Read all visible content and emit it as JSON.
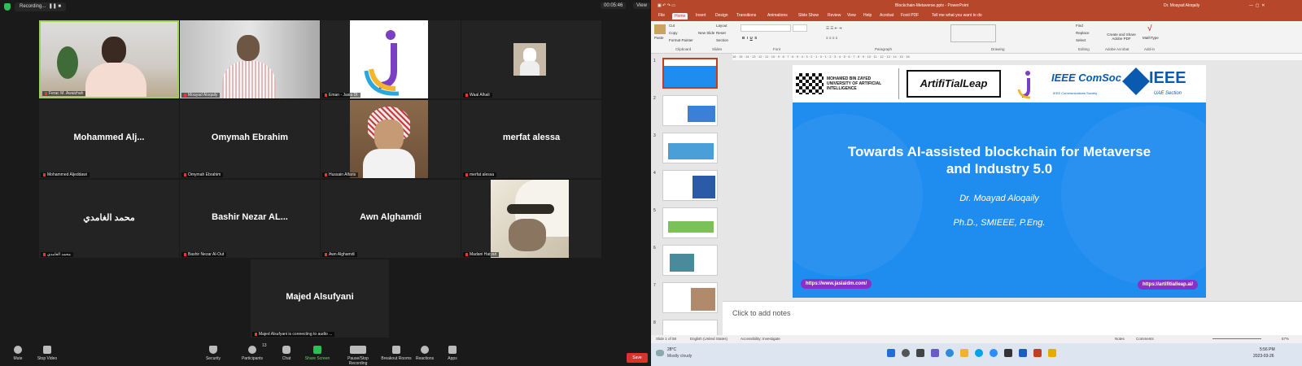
{
  "zoom": {
    "recording": "Recording...",
    "timer": "00:05:46",
    "view": "View",
    "tiles": [
      {
        "name": "Ferac M. Awaizhah",
        "big": ""
      },
      {
        "name": "Moayad Aloqaily",
        "big": ""
      },
      {
        "name": "Eman - Jasia Dt",
        "big": ""
      },
      {
        "name": "Waal Alhali",
        "big": ""
      },
      {
        "name": "Mohammed Aljeddawi",
        "big": "Mohammed  Alj..."
      },
      {
        "name": "Omymah Ebrahim",
        "big": "Omymah Ebrahim"
      },
      {
        "name": "Hussain Alfaris",
        "big": ""
      },
      {
        "name": "merfat alessa",
        "big": "merfat alessa"
      },
      {
        "name": "محمد الغامدي",
        "big": "محمد الغامدي"
      },
      {
        "name": "Bashir Nezar Al-Out",
        "big": "Bashir Nezar AL..."
      },
      {
        "name": "Awn Alghamdi",
        "big": "Awn Alghamdi"
      },
      {
        "name": "Madani Haiyari",
        "big": ""
      },
      {
        "name": "Majed Alsufyani is connecting to audio ...",
        "big": "Majed Alsufyani"
      }
    ],
    "toolbar": [
      "Mute",
      "Stop Video",
      "Security",
      "Participants",
      "Chat",
      "Share Screen",
      "Pause/Stop Recording",
      "Breakout Rooms",
      "Reactions",
      "Apps"
    ],
    "participants_count": "13",
    "save": "Save"
  },
  "ppt": {
    "title": "Blockchain-Metaverse.pptx - PowerPoint",
    "user": "Dr. Moayad Aloqaily",
    "tabs": [
      "File",
      "Home",
      "Insert",
      "Design",
      "Transitions",
      "Animations",
      "Slide Show",
      "Review",
      "View",
      "Help",
      "Acrobat",
      "Foxit PDF"
    ],
    "tell": "Tell me what you want to do",
    "groups": [
      "Clipboard",
      "Slides",
      "Font",
      "Paragraph",
      "Drawing",
      "Editing",
      "Adobe Acrobat",
      "Add-in"
    ],
    "clip": [
      "Paste",
      "Cut",
      "Copy",
      "Format Painter"
    ],
    "slidesgrp": [
      "New Slide",
      "Layout",
      "Reset",
      "Section"
    ],
    "edit": [
      "Find",
      "Replace",
      "Select"
    ],
    "adobe": "Create and Share Adobe PDF",
    "math": "MathType",
    "ruler": "16 · 15 · 14 · 13 · 12 · 11 · 10 · 9 · 8 · 7 · 6 · 5 · 4 · 3 · 2 · 1 · 0 · 1 · 2 · 3 · 4 · 5 · 6 · 7 · 8 · 9 · 10 · 11 · 12 · 13 · 14 · 15 · 16",
    "thumbs": [
      "1",
      "2",
      "3",
      "4",
      "5",
      "6",
      "7",
      "8"
    ],
    "slide": {
      "logo1": "MOHAMED BIN ZAYED UNIVERSITY OF ARTIFICIAL INTELLIGENCE",
      "logo2": "ArtifiTialLeap",
      "logo3": "IEEE ComSoc",
      "logo3sub": "IEEE Communications Society",
      "logo4": "IEEE",
      "logo4sub": "UAE Section",
      "title1": "Towards AI-assisted blockchain for Metaverse",
      "title2": "and Industry 5.0",
      "author": "Dr. Moayad Aloqaily",
      "creds": "Ph.D., SMIEEE, P.Eng.",
      "link1": "https://www.jasiaidm.com/",
      "link2": "https://artifitialleap.ai/"
    },
    "notes": "Click to add notes",
    "status_left": "Slide 1 of 58",
    "status_lang": "English (United States)",
    "status_access": "Accessibility: Investigate",
    "status_notes": "Notes",
    "status_comments": "Comments",
    "zoom": "67%",
    "weather_temp": "28°C",
    "weather_desc": "Mostly cloudy",
    "time": "5:56 PM",
    "date": "2023-03-26"
  }
}
